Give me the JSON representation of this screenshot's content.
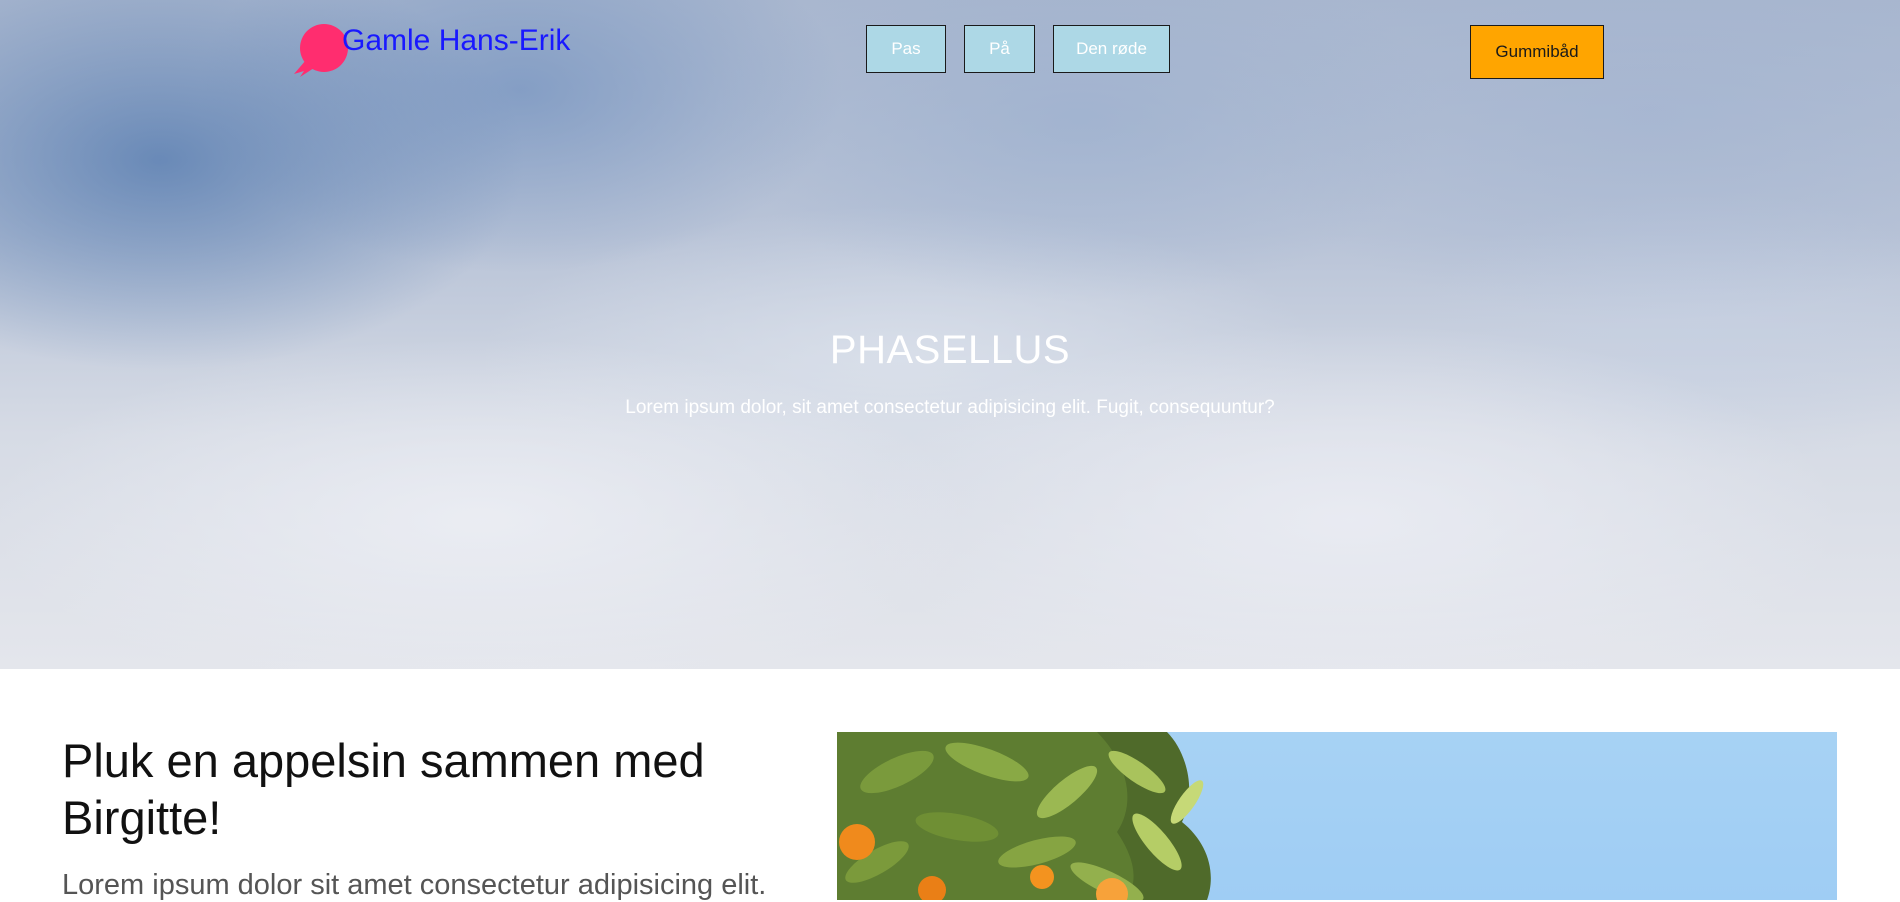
{
  "header": {
    "logo_text": "Gamle Hans-Erik",
    "nav": [
      {
        "label": "Pas"
      },
      {
        "label": "På"
      },
      {
        "label": "Den røde"
      }
    ],
    "cta_label": "Gummibåd"
  },
  "hero": {
    "title": "PHASELLUS",
    "subtitle": "Lorem ipsum dolor, sit amet consectetur adipisicing elit. Fugit, consequuntur?"
  },
  "section": {
    "heading": "Pluk en appelsin sammen med Birgitte!",
    "paragraph": "Lorem ipsum dolor sit amet consectetur adipisicing elit."
  },
  "colors": {
    "logo_icon": "#ff2d6f",
    "logo_text": "#1919ff",
    "nav_button_bg": "#add8e6",
    "cta_bg": "#ffa500"
  },
  "icons": {
    "logo": "speech-bubble-icon"
  }
}
